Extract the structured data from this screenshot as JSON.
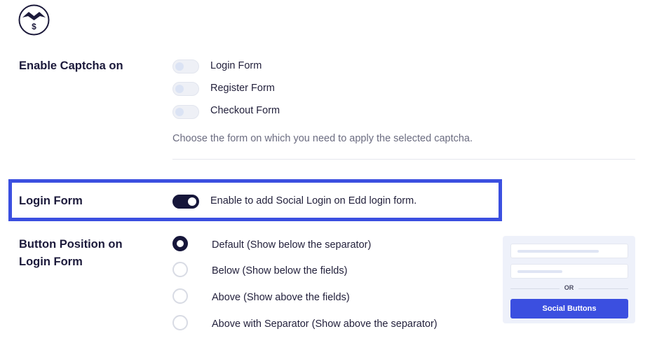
{
  "logo": {
    "icon": "dollar-bird-logo-icon",
    "symbol": "$"
  },
  "captcha": {
    "label": "Enable Captcha on",
    "options": [
      {
        "label": "Login Form",
        "enabled": false
      },
      {
        "label": "Register Form",
        "enabled": false
      },
      {
        "label": "Checkout Form",
        "enabled": false
      }
    ],
    "help": "Choose the form on which you need to apply the selected captcha."
  },
  "login_form": {
    "label": "Login Form",
    "enabled": true,
    "description": "Enable to add Social Login on Edd login form."
  },
  "button_position": {
    "label_line1": "Button Position on",
    "label_line2": "Login Form",
    "options": [
      {
        "label": "Default (Show below the separator)",
        "selected": true
      },
      {
        "label": "Below (Show below the fields)",
        "selected": false
      },
      {
        "label": "Above (Show above the fields)",
        "selected": false
      },
      {
        "label": "Above with Separator (Show above the separator)",
        "selected": false
      }
    ],
    "preview": {
      "separator_text": "OR",
      "button_label": "Social Buttons"
    }
  },
  "colors": {
    "accent": "#3b4fe0",
    "toggle_on": "#16163a",
    "text": "#1c1a3b",
    "muted": "#6b6c80"
  }
}
